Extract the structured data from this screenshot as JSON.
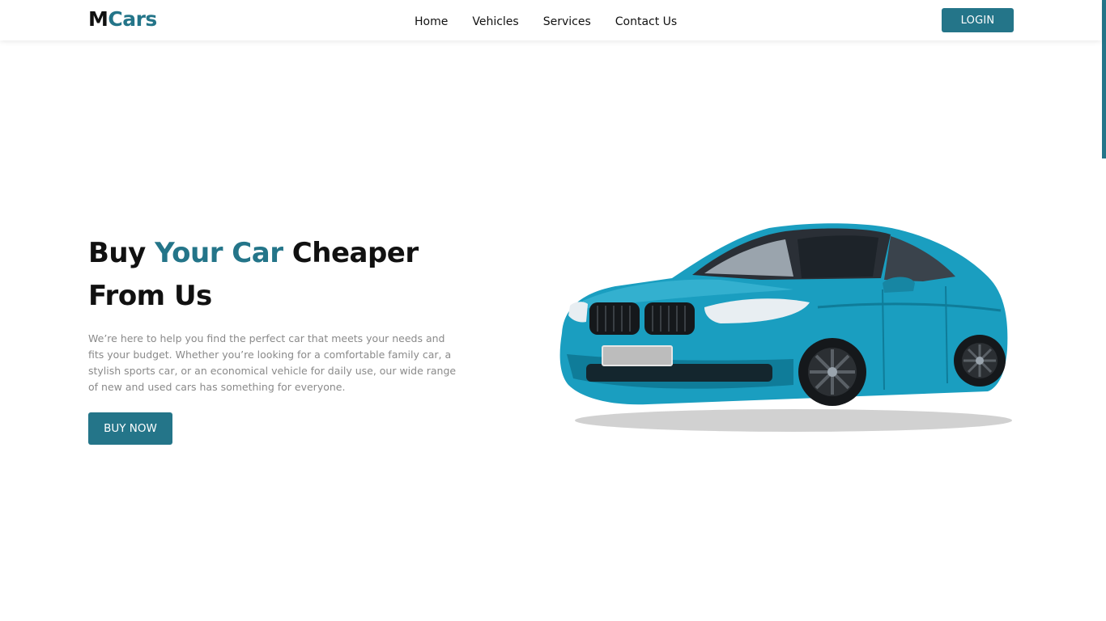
{
  "brand": {
    "logo_first": "M",
    "logo_rest": "Cars"
  },
  "nav": {
    "items": [
      {
        "label": "Home"
      },
      {
        "label": "Vehicles"
      },
      {
        "label": "Services"
      },
      {
        "label": "Contact Us"
      }
    ],
    "login_label": "LOGIN"
  },
  "hero": {
    "title_part1": "Buy ",
    "title_accent": "Your Car",
    "title_part2": " Cheaper",
    "title_line2": "From Us",
    "description": "We’re here to help you find the perfect car that meets your needs and fits your budget. Whether you’re looking for a comfortable family car, a stylish sports car, or an economical vehicle for daily use, our wide range of new and used cars has something for everyone.",
    "cta_label": "BUY NOW"
  },
  "colors": {
    "accent": "#247589",
    "car_body": "#1a9ec0",
    "text_dark": "#111111",
    "text_muted": "#8a8a8a"
  },
  "icons": {
    "hero_image": "blue-sedan-car-image"
  }
}
